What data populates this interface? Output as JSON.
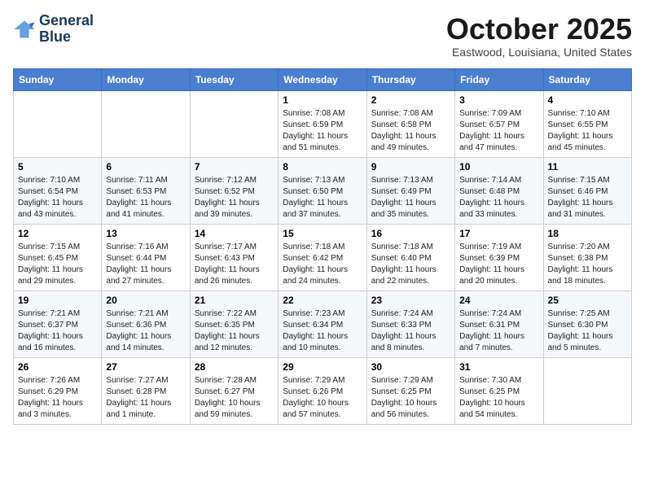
{
  "header": {
    "logo_line1": "General",
    "logo_line2": "Blue",
    "month_title": "October 2025",
    "location": "Eastwood, Louisiana, United States"
  },
  "days_of_week": [
    "Sunday",
    "Monday",
    "Tuesday",
    "Wednesday",
    "Thursday",
    "Friday",
    "Saturday"
  ],
  "weeks": [
    [
      {
        "day": "",
        "info": ""
      },
      {
        "day": "",
        "info": ""
      },
      {
        "day": "",
        "info": ""
      },
      {
        "day": "1",
        "info": "Sunrise: 7:08 AM\nSunset: 6:59 PM\nDaylight: 11 hours and 51 minutes."
      },
      {
        "day": "2",
        "info": "Sunrise: 7:08 AM\nSunset: 6:58 PM\nDaylight: 11 hours and 49 minutes."
      },
      {
        "day": "3",
        "info": "Sunrise: 7:09 AM\nSunset: 6:57 PM\nDaylight: 11 hours and 47 minutes."
      },
      {
        "day": "4",
        "info": "Sunrise: 7:10 AM\nSunset: 6:55 PM\nDaylight: 11 hours and 45 minutes."
      }
    ],
    [
      {
        "day": "5",
        "info": "Sunrise: 7:10 AM\nSunset: 6:54 PM\nDaylight: 11 hours and 43 minutes."
      },
      {
        "day": "6",
        "info": "Sunrise: 7:11 AM\nSunset: 6:53 PM\nDaylight: 11 hours and 41 minutes."
      },
      {
        "day": "7",
        "info": "Sunrise: 7:12 AM\nSunset: 6:52 PM\nDaylight: 11 hours and 39 minutes."
      },
      {
        "day": "8",
        "info": "Sunrise: 7:13 AM\nSunset: 6:50 PM\nDaylight: 11 hours and 37 minutes."
      },
      {
        "day": "9",
        "info": "Sunrise: 7:13 AM\nSunset: 6:49 PM\nDaylight: 11 hours and 35 minutes."
      },
      {
        "day": "10",
        "info": "Sunrise: 7:14 AM\nSunset: 6:48 PM\nDaylight: 11 hours and 33 minutes."
      },
      {
        "day": "11",
        "info": "Sunrise: 7:15 AM\nSunset: 6:46 PM\nDaylight: 11 hours and 31 minutes."
      }
    ],
    [
      {
        "day": "12",
        "info": "Sunrise: 7:15 AM\nSunset: 6:45 PM\nDaylight: 11 hours and 29 minutes."
      },
      {
        "day": "13",
        "info": "Sunrise: 7:16 AM\nSunset: 6:44 PM\nDaylight: 11 hours and 27 minutes."
      },
      {
        "day": "14",
        "info": "Sunrise: 7:17 AM\nSunset: 6:43 PM\nDaylight: 11 hours and 26 minutes."
      },
      {
        "day": "15",
        "info": "Sunrise: 7:18 AM\nSunset: 6:42 PM\nDaylight: 11 hours and 24 minutes."
      },
      {
        "day": "16",
        "info": "Sunrise: 7:18 AM\nSunset: 6:40 PM\nDaylight: 11 hours and 22 minutes."
      },
      {
        "day": "17",
        "info": "Sunrise: 7:19 AM\nSunset: 6:39 PM\nDaylight: 11 hours and 20 minutes."
      },
      {
        "day": "18",
        "info": "Sunrise: 7:20 AM\nSunset: 6:38 PM\nDaylight: 11 hours and 18 minutes."
      }
    ],
    [
      {
        "day": "19",
        "info": "Sunrise: 7:21 AM\nSunset: 6:37 PM\nDaylight: 11 hours and 16 minutes."
      },
      {
        "day": "20",
        "info": "Sunrise: 7:21 AM\nSunset: 6:36 PM\nDaylight: 11 hours and 14 minutes."
      },
      {
        "day": "21",
        "info": "Sunrise: 7:22 AM\nSunset: 6:35 PM\nDaylight: 11 hours and 12 minutes."
      },
      {
        "day": "22",
        "info": "Sunrise: 7:23 AM\nSunset: 6:34 PM\nDaylight: 11 hours and 10 minutes."
      },
      {
        "day": "23",
        "info": "Sunrise: 7:24 AM\nSunset: 6:33 PM\nDaylight: 11 hours and 8 minutes."
      },
      {
        "day": "24",
        "info": "Sunrise: 7:24 AM\nSunset: 6:31 PM\nDaylight: 11 hours and 7 minutes."
      },
      {
        "day": "25",
        "info": "Sunrise: 7:25 AM\nSunset: 6:30 PM\nDaylight: 11 hours and 5 minutes."
      }
    ],
    [
      {
        "day": "26",
        "info": "Sunrise: 7:26 AM\nSunset: 6:29 PM\nDaylight: 11 hours and 3 minutes."
      },
      {
        "day": "27",
        "info": "Sunrise: 7:27 AM\nSunset: 6:28 PM\nDaylight: 11 hours and 1 minute."
      },
      {
        "day": "28",
        "info": "Sunrise: 7:28 AM\nSunset: 6:27 PM\nDaylight: 10 hours and 59 minutes."
      },
      {
        "day": "29",
        "info": "Sunrise: 7:29 AM\nSunset: 6:26 PM\nDaylight: 10 hours and 57 minutes."
      },
      {
        "day": "30",
        "info": "Sunrise: 7:29 AM\nSunset: 6:25 PM\nDaylight: 10 hours and 56 minutes."
      },
      {
        "day": "31",
        "info": "Sunrise: 7:30 AM\nSunset: 6:25 PM\nDaylight: 10 hours and 54 minutes."
      },
      {
        "day": "",
        "info": ""
      }
    ]
  ]
}
